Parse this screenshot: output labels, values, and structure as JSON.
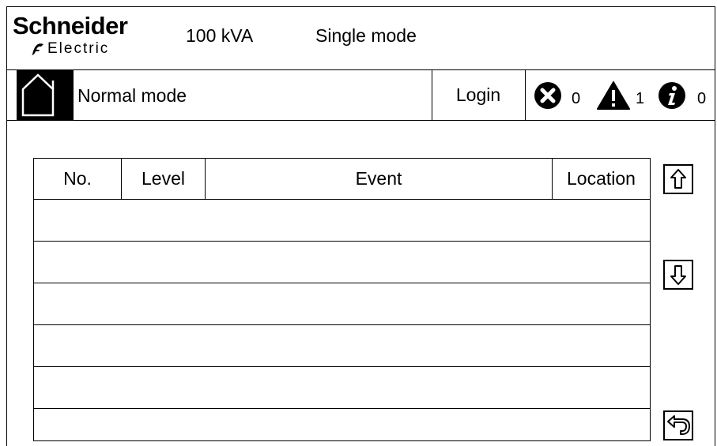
{
  "header": {
    "brand_name": "Schneider",
    "brand_sub": "Electric",
    "capacity": "100 kVA",
    "operation_mode": "Single mode"
  },
  "status": {
    "mode": "Normal mode",
    "login_label": "Login",
    "alarms": {
      "error_count": "0",
      "warning_count": "1",
      "info_count": "0"
    }
  },
  "event_table": {
    "columns": [
      "No.",
      "Level",
      "Event",
      "Location"
    ],
    "rows": [
      [
        "",
        "",
        "",
        ""
      ],
      [
        "",
        "",
        "",
        ""
      ],
      [
        "",
        "",
        "",
        ""
      ],
      [
        "",
        "",
        "",
        ""
      ],
      [
        "",
        "",
        "",
        ""
      ],
      [
        "",
        "",
        "",
        ""
      ]
    ]
  },
  "icons": {
    "home": "home-icon",
    "error": "error-x-icon",
    "warning": "warning-triangle-icon",
    "info": "info-icon",
    "scroll_up": "arrow-up-icon",
    "scroll_down": "arrow-down-icon",
    "back": "return-icon"
  }
}
